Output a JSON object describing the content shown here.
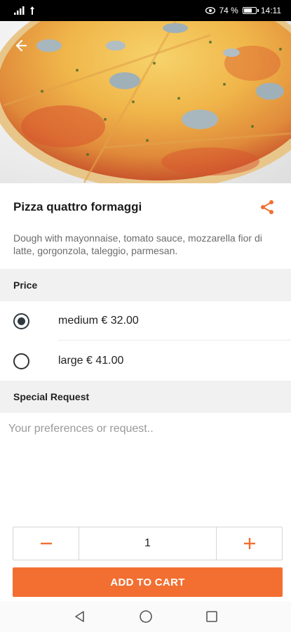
{
  "status_bar": {
    "battery_percent": "74 %",
    "battery_level": 0.74,
    "time": "14:11"
  },
  "product": {
    "title": "Pizza quattro formaggi",
    "description": "Dough with mayonnaise, tomato sauce, mozzarella fior di latte, gorgonzola, taleggio, parmesan."
  },
  "price_section": {
    "header": "Price",
    "options": [
      {
        "label": "medium  € 32.00",
        "selected": true
      },
      {
        "label": "large  € 41.00",
        "selected": false
      }
    ]
  },
  "special_request": {
    "header": "Special Request",
    "placeholder": "Your preferences or request..",
    "value": ""
  },
  "quantity": {
    "value": "1"
  },
  "cart": {
    "button_label": "ADD TO CART"
  },
  "colors": {
    "accent": "#f26f31",
    "radio": "#2f3a40"
  },
  "icons": {
    "back": "arrow-left-icon",
    "share": "share-icon",
    "minus": "minus-icon",
    "plus": "plus-icon",
    "nav_back": "triangle-back-icon",
    "nav_home": "circle-home-icon",
    "nav_recent": "square-recents-icon"
  }
}
